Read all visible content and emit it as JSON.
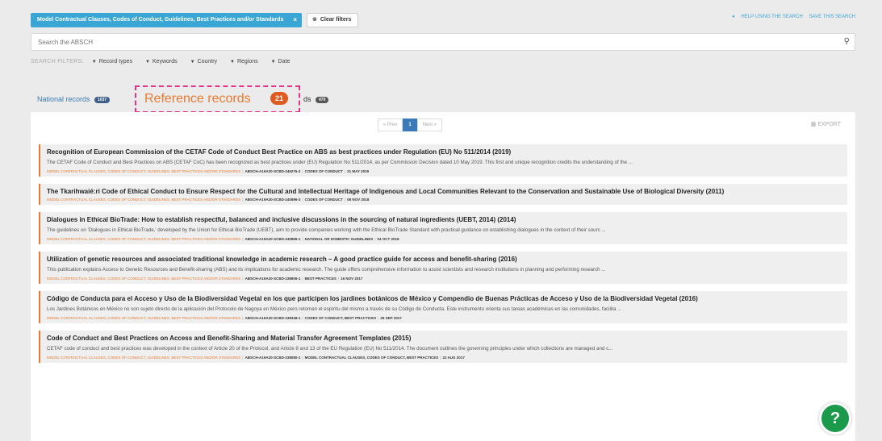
{
  "topbar": {
    "active_filter": "Model Contractual Clauses, Codes of Conduct, Guidelines, Best Practices and/or Standards",
    "active_filter_close": "×",
    "clear_icon": "x-circle-icon",
    "clear_label": "Clear filters",
    "help_link": "HELP USING THE SEARCH",
    "save_link": "SAVE THIS SEARCH"
  },
  "search": {
    "placeholder": "Search the ABSCH",
    "value": "",
    "icon": "search-icon"
  },
  "filters": {
    "label": "SEARCH FILTERS:",
    "items": [
      "Record types",
      "Keywords",
      "Country",
      "Regions",
      "Date"
    ]
  },
  "tabs": {
    "national": {
      "label": "National records",
      "count": "1037"
    },
    "reference": {
      "label": "Reference records",
      "count": "21"
    },
    "other": {
      "label": "ds",
      "count": "470"
    }
  },
  "pager": {
    "prev": "« Prev",
    "current": "1",
    "next": "Next »"
  },
  "export_label": "EXPORT",
  "records": [
    {
      "title": "Recognition of European Commission of the CETAF Code of Conduct Best Practice on ABS as best practices under Regulation (EU) No 511/2014 (2019)",
      "desc": "The CETAF Code of Conduct and Best Practices on ABS (CETAF CoC) has been recognized as best practices under (EU) Regulation No 511/2014, as per Commission Decision dated 10 May 2019. This first and unique recognition credits the understanding of the ...",
      "category": "MODEL CONTRACTUAL CLAUSES, CODES OF CONDUCT, GUIDELINES, BEST PRACTICES AND/OR STANDARDS",
      "id": "ABSCH-A19A20-SCBD-246276-2",
      "type": "CODES OF CONDUCT",
      "date": "21 MAY 2019"
    },
    {
      "title": "The Tkarihwaié:ri Code of Ethical Conduct to Ensure Respect for the Cultural and Intellectual Heritage of Indigenous and Local Communities Relevant to the Conservation and Sustainable Use of Biological Diversity (2011)",
      "desc": "",
      "category": "MODEL CONTRACTUAL CLAUSES, CODES OF CONDUCT, GUIDELINES, BEST PRACTICES AND/OR STANDARDS",
      "id": "ABSCH-A19A20-SCBD-240896-3",
      "type": "CODES OF CONDUCT",
      "date": "08 NOV 2018"
    },
    {
      "title": "Dialogues in Ethical BioTrade: How to establish respectful, balanced and inclusive discussions in the sourcing of natural ingredients (UEBT, 2014) (2014)",
      "desc": "The guidelines on 'Dialogues in Ethical BioTrade,' developed by the Union for Ethical BioTrade (UEBT), aim to provide companies working with the Ethical BioTrade Standard with practical guidance on establishing dialogues in the context of their sourc ...",
      "category": "MODEL CONTRACTUAL CLAUSES, CODES OF CONDUCT, GUIDELINES, BEST PRACTICES AND/OR STANDARDS",
      "id": "ABSCH-A19A20-SCBD-240899-1",
      "type": "NATIONAL OR DOMESTIC GUIDELINES",
      "date": "04 OCT 2018"
    },
    {
      "title": "Utilization of genetic resources and associated traditional knowledge in academic research – A good practice guide for access and benefit-sharing (2016)",
      "desc": "This publication explains Access to Genetic Resources and Benefit-sharing (ABS) and its implications for academic research. The guide offers comprehensive information to assist scientists and research institutions in planning and performing research ...",
      "category": "MODEL CONTRACTUAL CLAUSES, CODES OF CONDUCT, GUIDELINES, BEST PRACTICES AND/OR STANDARDS",
      "id": "ABSCH-A19A20-SCBD-238806-1",
      "type": "BEST PRACTICES",
      "date": "16 NOV 2017"
    },
    {
      "title": "Código de Conducta para el Acceso y Uso de la Biodiversidad Vegetal en los que participen los jardines botánicos de México y Compendio de Buenas Prácticas de Acceso y Uso de la Biodiversidad Vegetal (2016)",
      "desc": "Los Jardines Botánicos en México no son sujeto directo de la aplicación del Protocolo de Nagoya en México pero retoman el espíritu del mismo a través de su Código de Conducta. Este instrumento orienta sus tareas académicas en las comunidades, facilita ...",
      "category": "MODEL CONTRACTUAL CLAUSES, CODES OF CONDUCT, GUIDELINES, BEST PRACTICES AND/OR STANDARDS",
      "id": "ABSCH-A19A20-SCBD-238348-1",
      "type": "CODES OF CONDUCT, BEST PRACTICES",
      "date": "29 SEP 2017"
    },
    {
      "title": "Code of Conduct and Best Practices on Access and Benefit-Sharing and Material Transfer Agreement Templates (2015)",
      "desc": "CETAF code of conduct and best practices was developed in the context of Article 20 of the Protocol, and Article 8 and 13 of the EU Regulation (EU) No 511/2014. The document outlines the governing principles under which collections are managed and c...",
      "category": "MODEL CONTRACTUAL CLAUSES, CODES OF CONDUCT, GUIDELINES, BEST PRACTICES AND/OR STANDARDS",
      "id": "ABSCH-A19A20-SCBD-238080-1",
      "type": "MODEL CONTRACTUAL CLAUSES, CODES OF CONDUCT, BEST PRACTICES",
      "date": "22 AUG 2017"
    }
  ],
  "help_bubble": "?",
  "colors": {
    "accent": "#3aa6d6",
    "highlight": "#e0338a",
    "orange": "#e87a31",
    "help": "#1b9a4b"
  }
}
